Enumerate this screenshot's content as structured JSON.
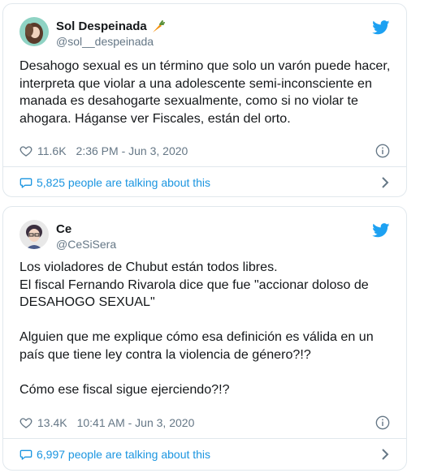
{
  "tweets": [
    {
      "display_name": "Sol Despeinada",
      "name_emoji": "carrot",
      "handle": "@sol__despeinada",
      "text": "Desahogo sexual es un término que solo un varón puede hacer,\ninterpreta que violar a una adolescente semi-inconsciente en\nmanada es desahogarte sexualmente, como si no violar te\nahogara. Háganse ver Fiscales, están del orto.",
      "likes": "11.6K",
      "timestamp": "2:36 PM - Jun 3, 2020",
      "talking": "5,825 people are talking about this"
    },
    {
      "display_name": "Ce",
      "handle": "@CeSiSera",
      "text": "Los violadores de Chubut están todos libres.\nEl fiscal Fernando Rivarola dice que fue \"accionar doloso de\nDESAHOGO SEXUAL\"\n\nAlguien que me explique cómo esa definición es válida en un\npaís que tiene ley contra la violencia de género?!?\n\nCómo ese fiscal sigue ejerciendo?!?",
      "likes": "13.4K",
      "timestamp": "10:41 AM - Jun 3, 2020",
      "talking": "6,997 people are talking about this"
    }
  ],
  "icons": {
    "bird": "twitter-bird-icon",
    "heart": "heart-icon",
    "info": "info-icon",
    "bubble": "speech-bubble-icon",
    "chevron": "chevron-right-icon"
  },
  "colors": {
    "brand": "#1da1f2",
    "link": "#1b95e0",
    "text": "#14171a",
    "secondary": "#657786",
    "border": "#e1e8ed"
  }
}
